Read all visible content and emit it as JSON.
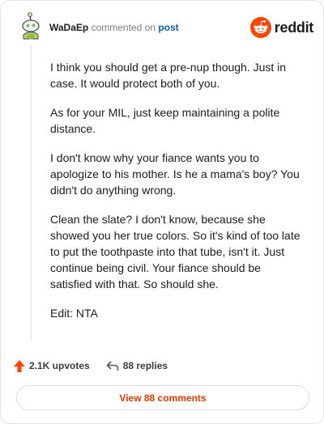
{
  "comment": {
    "username": "WaDaEp",
    "action_text": "commented on",
    "post_link_label": "post",
    "paragraphs": [
      "I think you should get a pre-nup though. Just in case. It would protect both of you.",
      "As for your MIL, just keep maintaining a polite distance.",
      "I don't know why your fiance wants you to apologize to his mother. Is he a mama's boy? You didn't do anything wrong.",
      "Clean the slate? I don't know, because she showed you her true colors. So it's kind of too late to put the toothpaste into that tube, isn't it. Just continue being civil. Your fiance should be satisfied with that. So should she.",
      "Edit: NTA"
    ]
  },
  "brand": {
    "name": "reddit",
    "logo_icon": "reddit-alien-icon",
    "color": "#ff4500"
  },
  "stats": {
    "upvotes_label": "2.1K upvotes",
    "upvote_icon": "upvote-arrow-icon",
    "upvote_color": "#ff4500",
    "replies_label": "88 replies",
    "reply_icon": "reply-arrow-icon"
  },
  "footer": {
    "view_comments_label": "View 88 comments",
    "accent_color": "#d93a00"
  }
}
